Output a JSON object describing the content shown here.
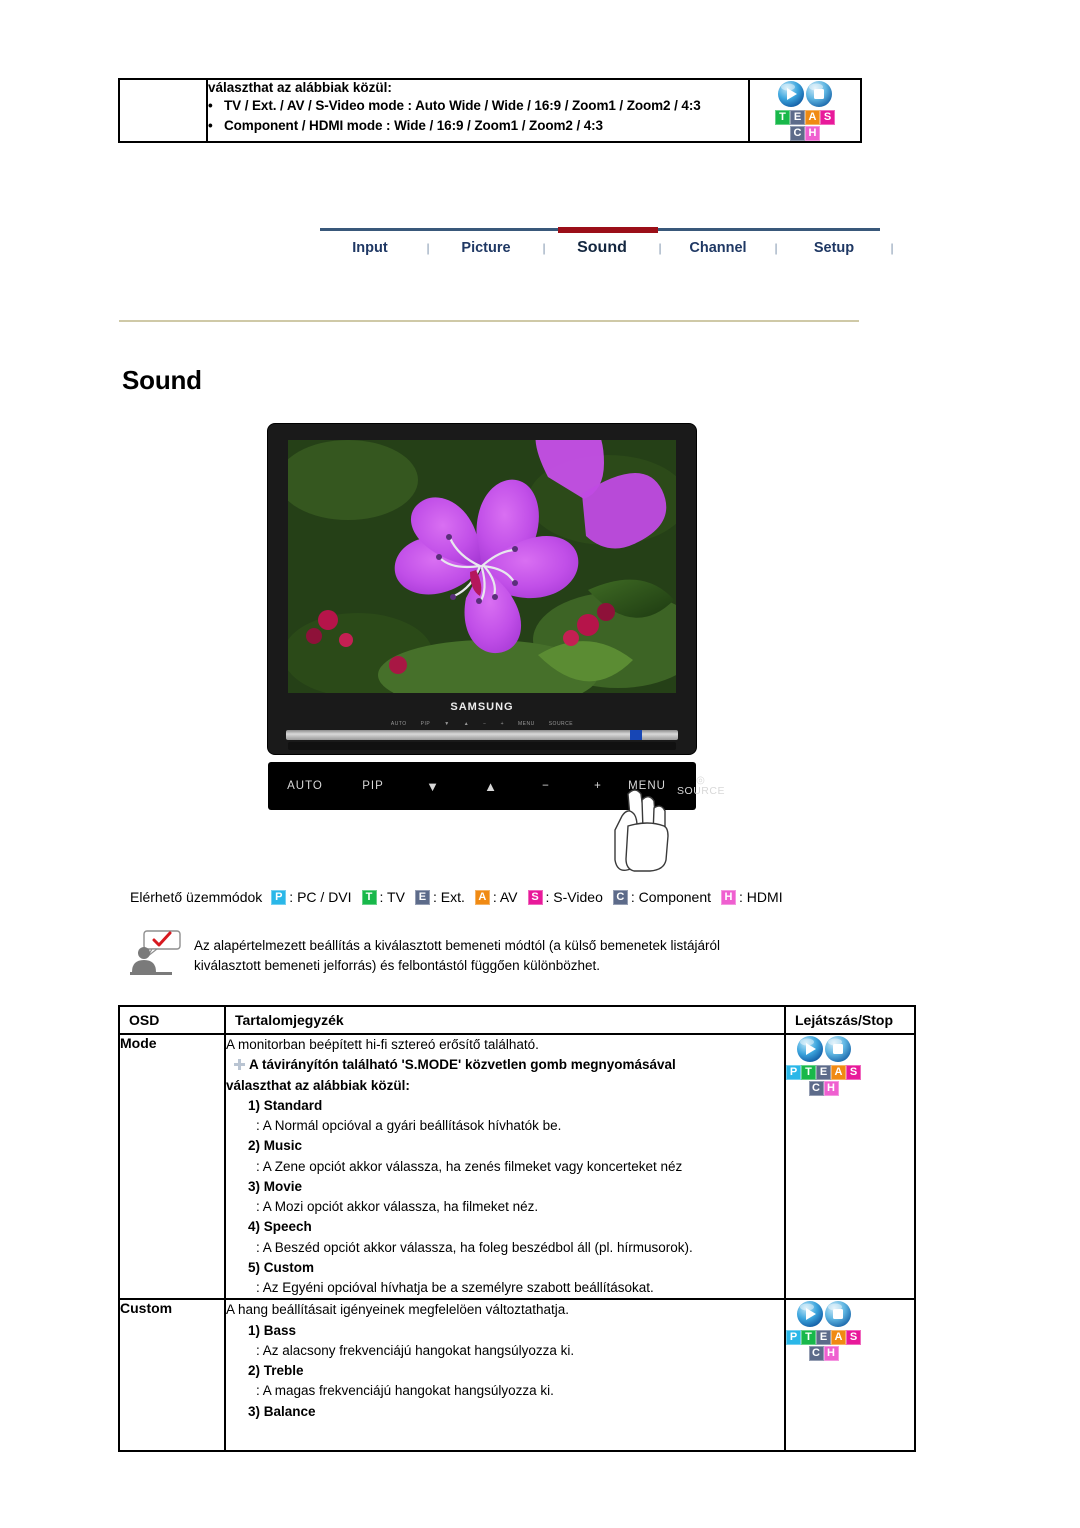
{
  "top_box": {
    "intro": "választhat az alábbiak közül:",
    "bullets": [
      "TV / Ext. / AV / S-Video mode : Auto Wide / Wide / 16:9 / Zoom1 / Zoom2 / 4:3",
      "Component / HDMI mode : Wide / 16:9 / Zoom1 / Zoom2 / 4:3"
    ],
    "badge_letters_row1": [
      "T",
      "E",
      "A",
      "S"
    ],
    "badge_letters_row2": [
      "C",
      "H"
    ]
  },
  "nav": {
    "tabs": [
      {
        "label": "Input",
        "active": false
      },
      {
        "label": "Picture",
        "active": false
      },
      {
        "label": "Sound",
        "active": true
      },
      {
        "label": "Channel",
        "active": false
      },
      {
        "label": "Setup",
        "active": false
      }
    ],
    "separator": "|",
    "active_color": "#9b0f18",
    "line_color": "#39587a",
    "text_color": "#1f3864"
  },
  "page_title": "Sound",
  "monitor": {
    "brand": "SAMSUNG",
    "micro_labels": [
      "AUTO",
      "PIP",
      "▼",
      "▲",
      "−",
      "+",
      "MENU",
      "SOURCE"
    ],
    "controls": [
      "AUTO",
      "PIP",
      "▼",
      "▲",
      "−",
      "+",
      "MENU",
      "SOURCE"
    ]
  },
  "modes_line": {
    "label": "Elérhető üzemmódok",
    "items": [
      {
        "letter": "P",
        "color": "#2ab7e8",
        "text": ": PC / DVI"
      },
      {
        "letter": "T",
        "color": "#18b84a",
        "text": ": TV"
      },
      {
        "letter": "E",
        "color": "#5d6b8a",
        "text": ": Ext."
      },
      {
        "letter": "A",
        "color": "#f08a13",
        "text": ": AV"
      },
      {
        "letter": "S",
        "color": "#e8199a",
        "text": ": S-Video"
      },
      {
        "letter": "C",
        "color": "#5d6b8a",
        "text": ": Component"
      },
      {
        "letter": "H",
        "color": "#ef5fd0",
        "text": ": HDMI"
      }
    ]
  },
  "note": {
    "line1": "Az alapértelmezett beállítás a kiválasztott bemeneti módtól (a külső bemenetek listájáról",
    "line2": "kiválasztott bemeneti jelforrás) és felbontástól függően különbözhet."
  },
  "table": {
    "headers": {
      "osd": "OSD",
      "contents": "Tartalomjegyzék",
      "play": "Lejátszás/Stop"
    },
    "rows": [
      {
        "osd": "Mode",
        "intro": "A monitorban beépített hi-fi sztereó erősítő található.",
        "plus_line_1": "A távirányítón található 'S.MODE' közvetlen gomb megnyomásával",
        "plus_line_2": "választhat az alábbiak közül:",
        "items": [
          {
            "num": "1) Standard",
            "desc": ": A Normál opcióval a gyári beállítások hívhatók be."
          },
          {
            "num": "2) Music",
            "desc": ": A Zene opciót akkor válassza, ha zenés filmeket vagy koncerteket néz"
          },
          {
            "num": "3) Movie",
            "desc": ": A Mozi opciót akkor válassza, ha filmeket néz."
          },
          {
            "num": "4) Speech",
            "desc": ": A Beszéd opciót akkor válassza, ha foleg beszédbol áll (pl. hírmusorok)."
          },
          {
            "num": "5) Custom",
            "desc": ": Az Egyéni opcióval hívhatja be a személyre szabott beállításokat."
          }
        ],
        "badge_row1": [
          "P",
          "T",
          "E",
          "A",
          "S"
        ],
        "badge_row2": [
          "C",
          "H"
        ]
      },
      {
        "osd": "Custom",
        "intro": "A hang beállításait igényeinek megfelelöen változtathatja.",
        "items": [
          {
            "num": "1) Bass",
            "desc": ": Az alacsony frekvenciájú hangokat hangsúlyozza ki."
          },
          {
            "num": "2) Treble",
            "desc": ": A magas frekvenciájú hangokat hangsúlyozza ki."
          },
          {
            "num": "3) Balance",
            "desc": ""
          }
        ],
        "badge_row1": [
          "P",
          "T",
          "E",
          "A",
          "S"
        ],
        "badge_row2": [
          "C",
          "H"
        ]
      }
    ]
  }
}
